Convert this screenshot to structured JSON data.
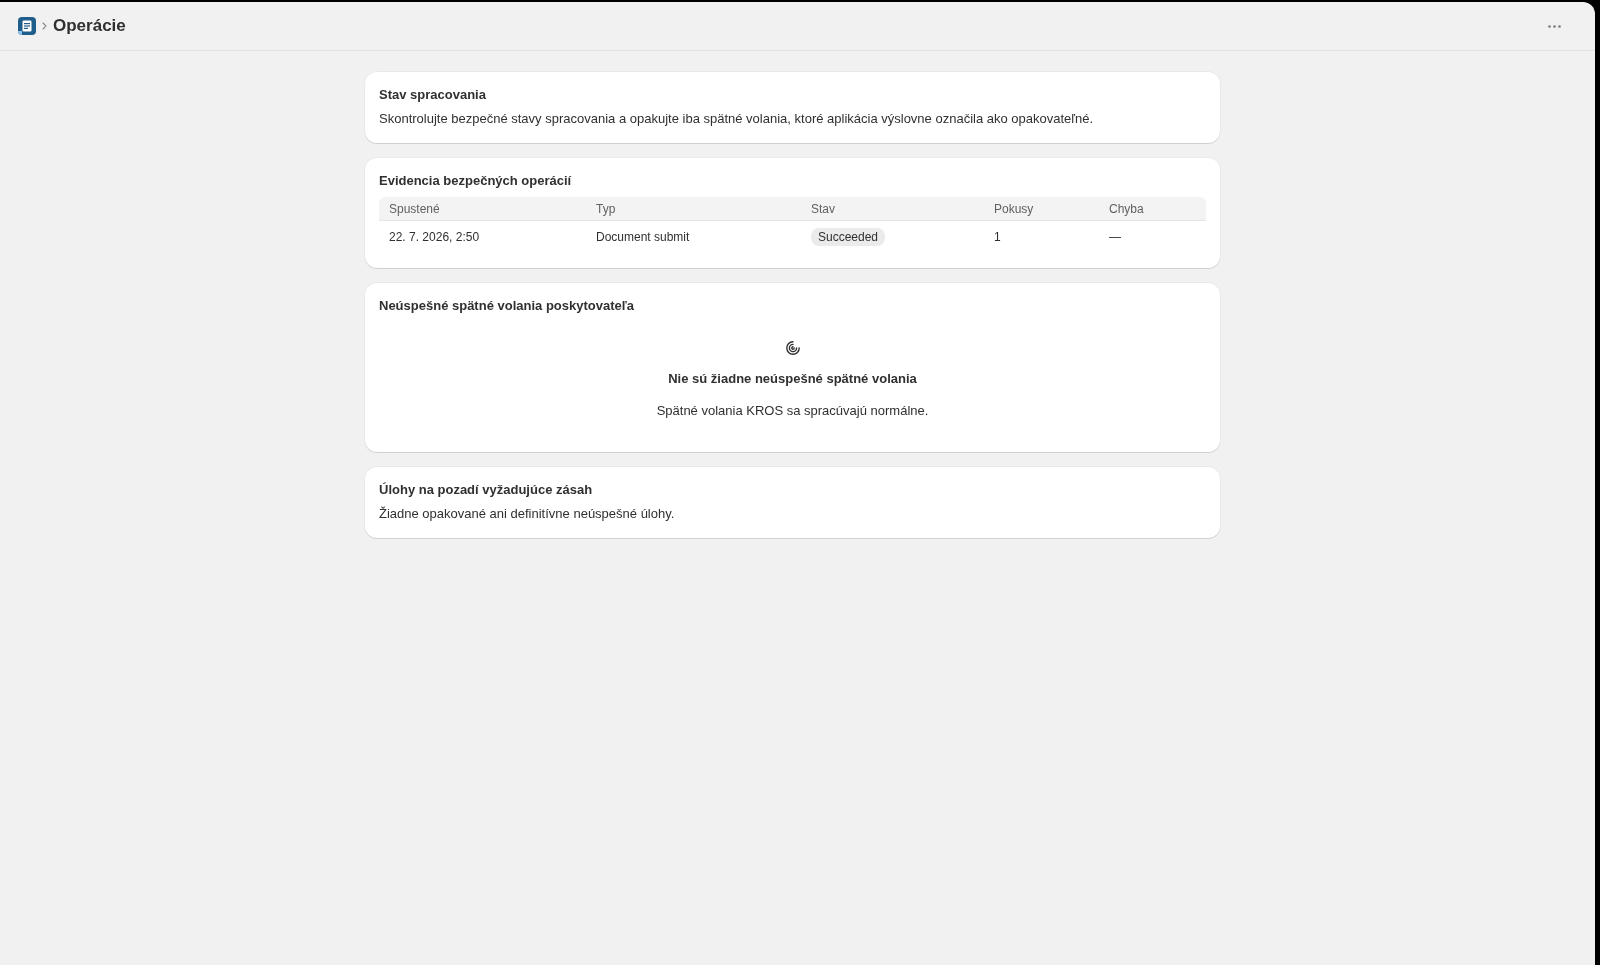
{
  "header": {
    "title": "Operácie"
  },
  "cards": [
    {
      "kind": "text",
      "title": "Stav spracovania",
      "description": "Skontrolujte bezpečné stavy spracovania a opakujte iba spätné volania, ktoré aplikácia výslovne označila ako opakovateľné."
    },
    {
      "kind": "table",
      "title": "Evidencia bezpečných operácií",
      "columns": [
        {
          "label": "Spustené",
          "kind": "text"
        },
        {
          "label": "Typ",
          "kind": "text"
        },
        {
          "label": "Stav",
          "kind": "badge"
        },
        {
          "label": "Pokusy",
          "kind": "text"
        },
        {
          "label": "Chyba",
          "kind": "text"
        }
      ],
      "rows": [
        {
          "cells": [
            "22. 7. 2026, 2:50",
            "Document submit",
            "Succeeded",
            "1",
            "—"
          ]
        }
      ]
    },
    {
      "kind": "empty_state",
      "title": "Neúspešné spätné volania poskytovateľa",
      "empty_title": "Nie sú žiadne neúspešné spätné volania",
      "empty_description": "Spätné volania KROS sa spracúvajú normálne."
    },
    {
      "kind": "text",
      "title": "Úlohy na pozadí vyžadujúce zásah",
      "description": "Žiadne opakované ani definitívne neúspešné úlohy."
    }
  ]
}
